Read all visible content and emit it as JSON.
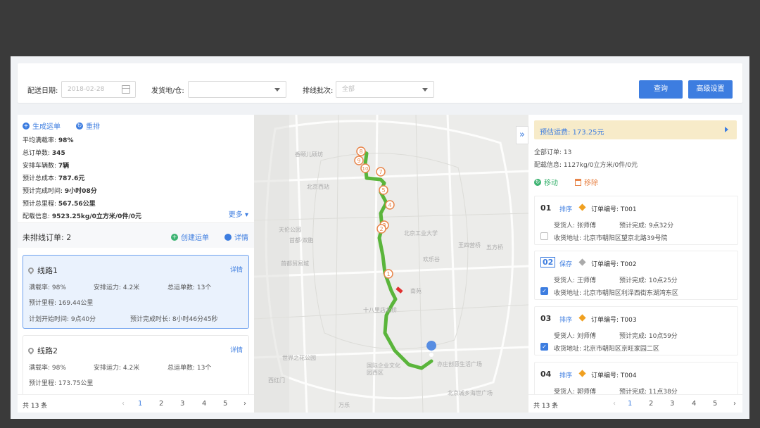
{
  "filters": {
    "date_label": "配送日期:",
    "date_value": "2018-02-28",
    "origin_label": "发货地/仓:",
    "origin_value": "",
    "batch_label": "排线批次:",
    "batch_value": "全部",
    "query_button": "查询",
    "advanced_button": "高级设置"
  },
  "left": {
    "actions": {
      "create": "生成运单",
      "rerank": "重排"
    },
    "stats": [
      {
        "label": "平均满载率:",
        "value": "98%"
      },
      {
        "label": "总订单数:",
        "value": "345"
      },
      {
        "label": "安排车辆数:",
        "value": "7辆"
      },
      {
        "label": "预计总成本:",
        "value": "787.6元"
      },
      {
        "label": "预计完成时间:",
        "value": "9小时08分"
      },
      {
        "label": "预计总里程:",
        "value": "567.56公里"
      },
      {
        "label": "配载信息:",
        "value": "9523.25kg/0立方米/0件/0元"
      }
    ],
    "more": "更多",
    "unrouted": {
      "label": "未排线订单:",
      "count": "2",
      "create": "创建运单",
      "detail": "详情"
    },
    "routes": [
      {
        "name": "线路1",
        "detail": "详情",
        "load_label": "满载率:",
        "load": "98%",
        "capacity_label": "安排运力:",
        "capacity": "4.2米",
        "orders_label": "总运单数:",
        "orders": "13个",
        "mileage_label": "预计里程:",
        "mileage": "169.44公里",
        "start_label": "计划开始时间:",
        "start": "9点40分",
        "duration_label": "预计完成时长:",
        "duration": "8小时46分45秒"
      },
      {
        "name": "线路2",
        "detail": "详情",
        "load_label": "满载率:",
        "load": "98%",
        "capacity_label": "安排运力:",
        "capacity": "4.2米",
        "orders_label": "总运单数:",
        "orders": "13个",
        "mileage_label": "预计里程:",
        "mileage": "173.75公里"
      }
    ],
    "pager": {
      "total": "共 13 条",
      "pages": [
        "1",
        "2",
        "3",
        "4",
        "5"
      ],
      "current": "1"
    }
  },
  "map": {
    "labels": [
      "香颐儿硕坊",
      "北京西站",
      "天伦公园",
      "首都·双胞",
      "北京工业大学",
      "王四营桥",
      "五方桥",
      "首都贸易城",
      "欢乐谷",
      "南苑",
      "十八里店北桥",
      "世界之花公园",
      "国际企业文化园西区",
      "亦庄创意生活广场",
      "北京城乡海世广场",
      "西红门",
      "万乐"
    ],
    "stop_numbers": [
      "8",
      "9",
      "10",
      "7",
      "5",
      "4",
      "3",
      "2",
      "1"
    ]
  },
  "right": {
    "fee": "预估运费: 173.25元",
    "total_orders": "全部订单: 13",
    "load_info": "配载信息: 1127kg/0立方米/0件/0元",
    "move": "移动",
    "remove": "移除",
    "orders": [
      {
        "no": "01",
        "op": "排序",
        "order_id": "订单编号: T001",
        "receiver": "受货人: 张师傅",
        "eta": "预计完成: 9点32分",
        "address": "收货地址: 北京市朝阳区望京北路39号院",
        "checked": false
      },
      {
        "no": "02",
        "op": "保存",
        "order_id": "订单编号: T002",
        "receiver": "受货人: 王师傅",
        "eta": "预计完成: 10点25分",
        "address": "收货地址: 北京市朝阳区利泽西街东湖湾东区",
        "checked": true
      },
      {
        "no": "03",
        "op": "排序",
        "order_id": "订单编号: T003",
        "receiver": "受货人: 刘师傅",
        "eta": "预计完成: 10点59分",
        "address": "收货地址: 北京市朝阳区京旺家园二区",
        "checked": true
      },
      {
        "no": "04",
        "op": "排序",
        "order_id": "订单编号: T004",
        "receiver": "受货人: 郭师傅",
        "eta": "预计完成: 11点38分",
        "address": "",
        "checked": false
      }
    ],
    "pager": {
      "total": "共 13 条",
      "pages": [
        "1",
        "2",
        "3",
        "4",
        "5"
      ],
      "current": "1"
    }
  },
  "colors": {
    "accent": "#3d7de0",
    "route": "#5ab53b",
    "marker": "#e8854a",
    "fee_bg": "#f7ebc9"
  }
}
